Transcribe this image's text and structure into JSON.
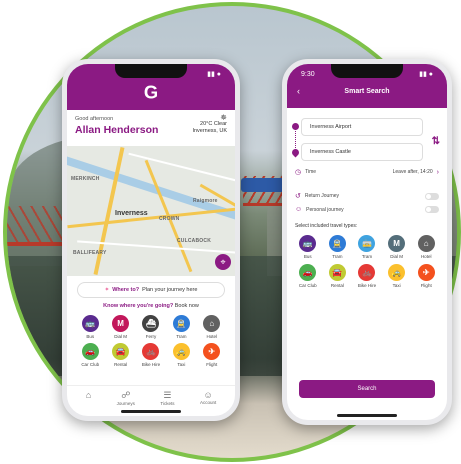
{
  "colors": {
    "brand": "#8b1a83",
    "bus": "#5a2b8f",
    "dialm": "#c2185b",
    "ferry": "#424242",
    "tram": "#2e7bd6",
    "hotel": "#616161",
    "carclub": "#4caf50",
    "rental": "#c0ca33",
    "bike": "#e53935",
    "taxi": "#fbc02d",
    "flight": "#f4511e"
  },
  "phone1": {
    "status_right": "▮▮ ●",
    "logo_letter": "G",
    "greeting": "Good afternoon",
    "user_name": "Allan Henderson",
    "weather_icon": "✵",
    "weather_text": "20°C Clear",
    "location": "Inverness, UK",
    "map_labels": {
      "merkinch": "MERKINCH",
      "inverness": "Inverness",
      "crown": "CROWN",
      "raigmore": "Raigmore",
      "culcabock": "CULCABOCK",
      "balloch": "BALLIFEARY"
    },
    "where_prefix": "Where to?",
    "where_suffix": "Plan your journey here",
    "know_prefix": "Know where you're going?",
    "know_suffix": "Book now",
    "transport": [
      {
        "label": "Bus",
        "icon": "🚌"
      },
      {
        "label": "Dial M",
        "icon": "M"
      },
      {
        "label": "Ferry",
        "icon": "⛴"
      },
      {
        "label": "Tram",
        "icon": "🚊"
      },
      {
        "label": "Hotel",
        "icon": "⌂"
      },
      {
        "label": "Car Club",
        "icon": "🚗"
      },
      {
        "label": "Rental",
        "icon": "🚘"
      },
      {
        "label": "Bike Hire",
        "icon": "🚲"
      },
      {
        "label": "Taxi",
        "icon": "🚕"
      },
      {
        "label": "Flight",
        "icon": "✈"
      }
    ],
    "tabs": [
      {
        "label": "",
        "icon": "⌂"
      },
      {
        "label": "Journeys",
        "icon": "☍"
      },
      {
        "label": "Tickets",
        "icon": "☰"
      },
      {
        "label": "Account",
        "icon": "☺"
      }
    ]
  },
  "phone2": {
    "time": "9:30",
    "status_right": "▮▮ ●",
    "back_icon": "‹",
    "title": "Smart Search",
    "from": "Inverness Airport",
    "to": "Inverness Castle",
    "swap_icon": "⇅",
    "time_label": "Time",
    "time_value": "Leave after, 14:20",
    "time_chevron": "›",
    "return_label": "Return Journey",
    "personal_label": "Personal journey",
    "select_label": "Select included travel types:",
    "transport": [
      {
        "label": "Bus",
        "icon": "🚌"
      },
      {
        "label": "Tram",
        "icon": "🚊"
      },
      {
        "label": "Tram",
        "icon": "🚋"
      },
      {
        "label": "Dial M",
        "icon": "M"
      },
      {
        "label": "Hotel",
        "icon": "⌂"
      },
      {
        "label": "Car Club",
        "icon": "🚗"
      },
      {
        "label": "Rental",
        "icon": "🚘"
      },
      {
        "label": "Bike Hire",
        "icon": "🚲"
      },
      {
        "label": "Taxi",
        "icon": "🚕"
      },
      {
        "label": "Flight",
        "icon": "✈"
      }
    ],
    "search_label": "Search"
  }
}
